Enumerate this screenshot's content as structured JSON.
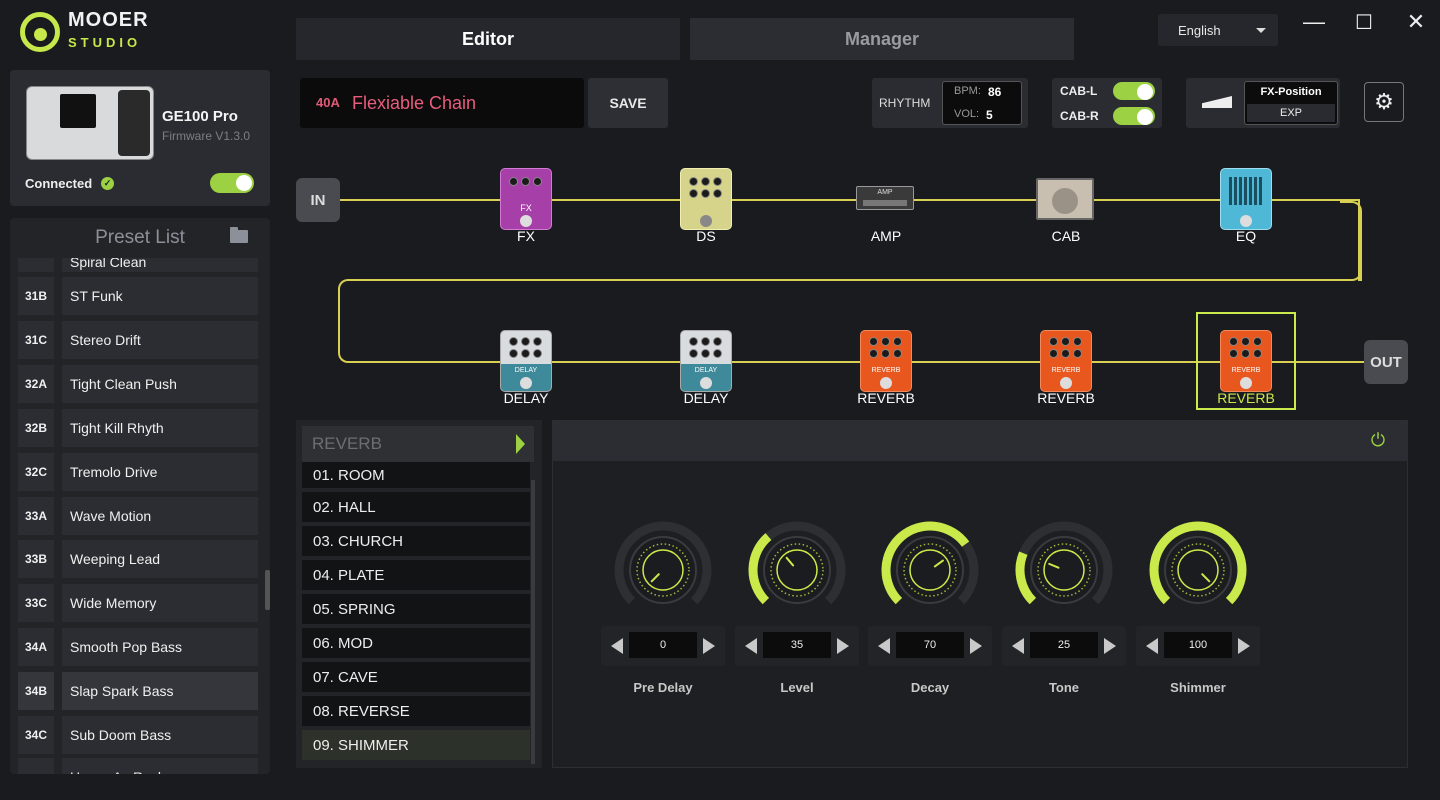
{
  "app": {
    "logo_top": "MOOER",
    "logo_bottom": "STUDIO"
  },
  "tabs": [
    {
      "label": "Editor",
      "active": true
    },
    {
      "label": "Manager",
      "active": false
    }
  ],
  "language": {
    "selected": "English"
  },
  "window_controls": {
    "minimize": "—",
    "maximize": "☐",
    "close": "✕"
  },
  "device": {
    "name": "GE100 Pro",
    "firmware": "Firmware V1.3.0",
    "status": "Connected",
    "connected": true
  },
  "preset_list": {
    "title": "Preset List",
    "partial_top": "Spiral Clean",
    "items": [
      {
        "num": "31B",
        "name": "ST Funk"
      },
      {
        "num": "31C",
        "name": "Stereo Drift"
      },
      {
        "num": "32A",
        "name": "Tight Clean Push"
      },
      {
        "num": "32B",
        "name": "Tight Kill Rhyth"
      },
      {
        "num": "32C",
        "name": "Tremolo Drive"
      },
      {
        "num": "33A",
        "name": "Wave Motion"
      },
      {
        "num": "33B",
        "name": "Weeping Lead"
      },
      {
        "num": "33C",
        "name": "Wide Memory"
      },
      {
        "num": "34A",
        "name": "Smooth Pop Bass"
      },
      {
        "num": "34B",
        "name": "Slap Spark Bass"
      },
      {
        "num": "34C",
        "name": "Sub Doom Bass"
      }
    ],
    "partial_bottom": "Heavy As Rock"
  },
  "current_preset": {
    "num": "40A",
    "name": "Flexiable Chain"
  },
  "save_label": "SAVE",
  "rhythm": {
    "label": "RHYTHM",
    "bpm_key": "BPM:",
    "bpm": "86",
    "vol_key": "VOL:",
    "vol": "5"
  },
  "cab": {
    "left_label": "CAB-L",
    "right_label": "CAB-R",
    "left_on": true,
    "right_on": true
  },
  "expression": {
    "title": "FX-Position",
    "value": "EXP"
  },
  "chain": {
    "in_label": "IN",
    "out_label": "OUT",
    "top_row": [
      "FX",
      "DS",
      "AMP",
      "CAB",
      "EQ"
    ],
    "bottom_row": [
      "DELAY",
      "DELAY",
      "REVERB",
      "REVERB",
      "REVERB"
    ],
    "pedal_text": {
      "fx": "FX",
      "delay": "DELAY",
      "reverb": "REVERB",
      "amp": "AMP"
    },
    "selected": "REVERB"
  },
  "effect_list": {
    "category": "REVERB",
    "items": [
      "01.  ROOM",
      "02.  HALL",
      "03.  CHURCH",
      "04.  PLATE",
      "05.  SPRING",
      "06.  MOD",
      "07.  CAVE",
      "08.  REVERSE",
      "09.  SHIMMER"
    ],
    "selected": "09.  SHIMMER"
  },
  "params": [
    {
      "label": "Pre Delay",
      "value": "0",
      "max": 100
    },
    {
      "label": "Level",
      "value": "35",
      "max": 100
    },
    {
      "label": "Decay",
      "value": "70",
      "max": 100
    },
    {
      "label": "Tone",
      "value": "25",
      "max": 100
    },
    {
      "label": "Shimmer",
      "value": "100",
      "max": 100
    }
  ],
  "colors": {
    "accent": "#c9ea4a",
    "preset_name": "#e85c7c",
    "chain_line": "#d9cf52",
    "reverb_pedal": "#e8571e"
  },
  "icons": {
    "settings": "gear-icon",
    "power": "power-icon",
    "folder": "folder-icon",
    "expression": "expression-pedal-icon"
  }
}
